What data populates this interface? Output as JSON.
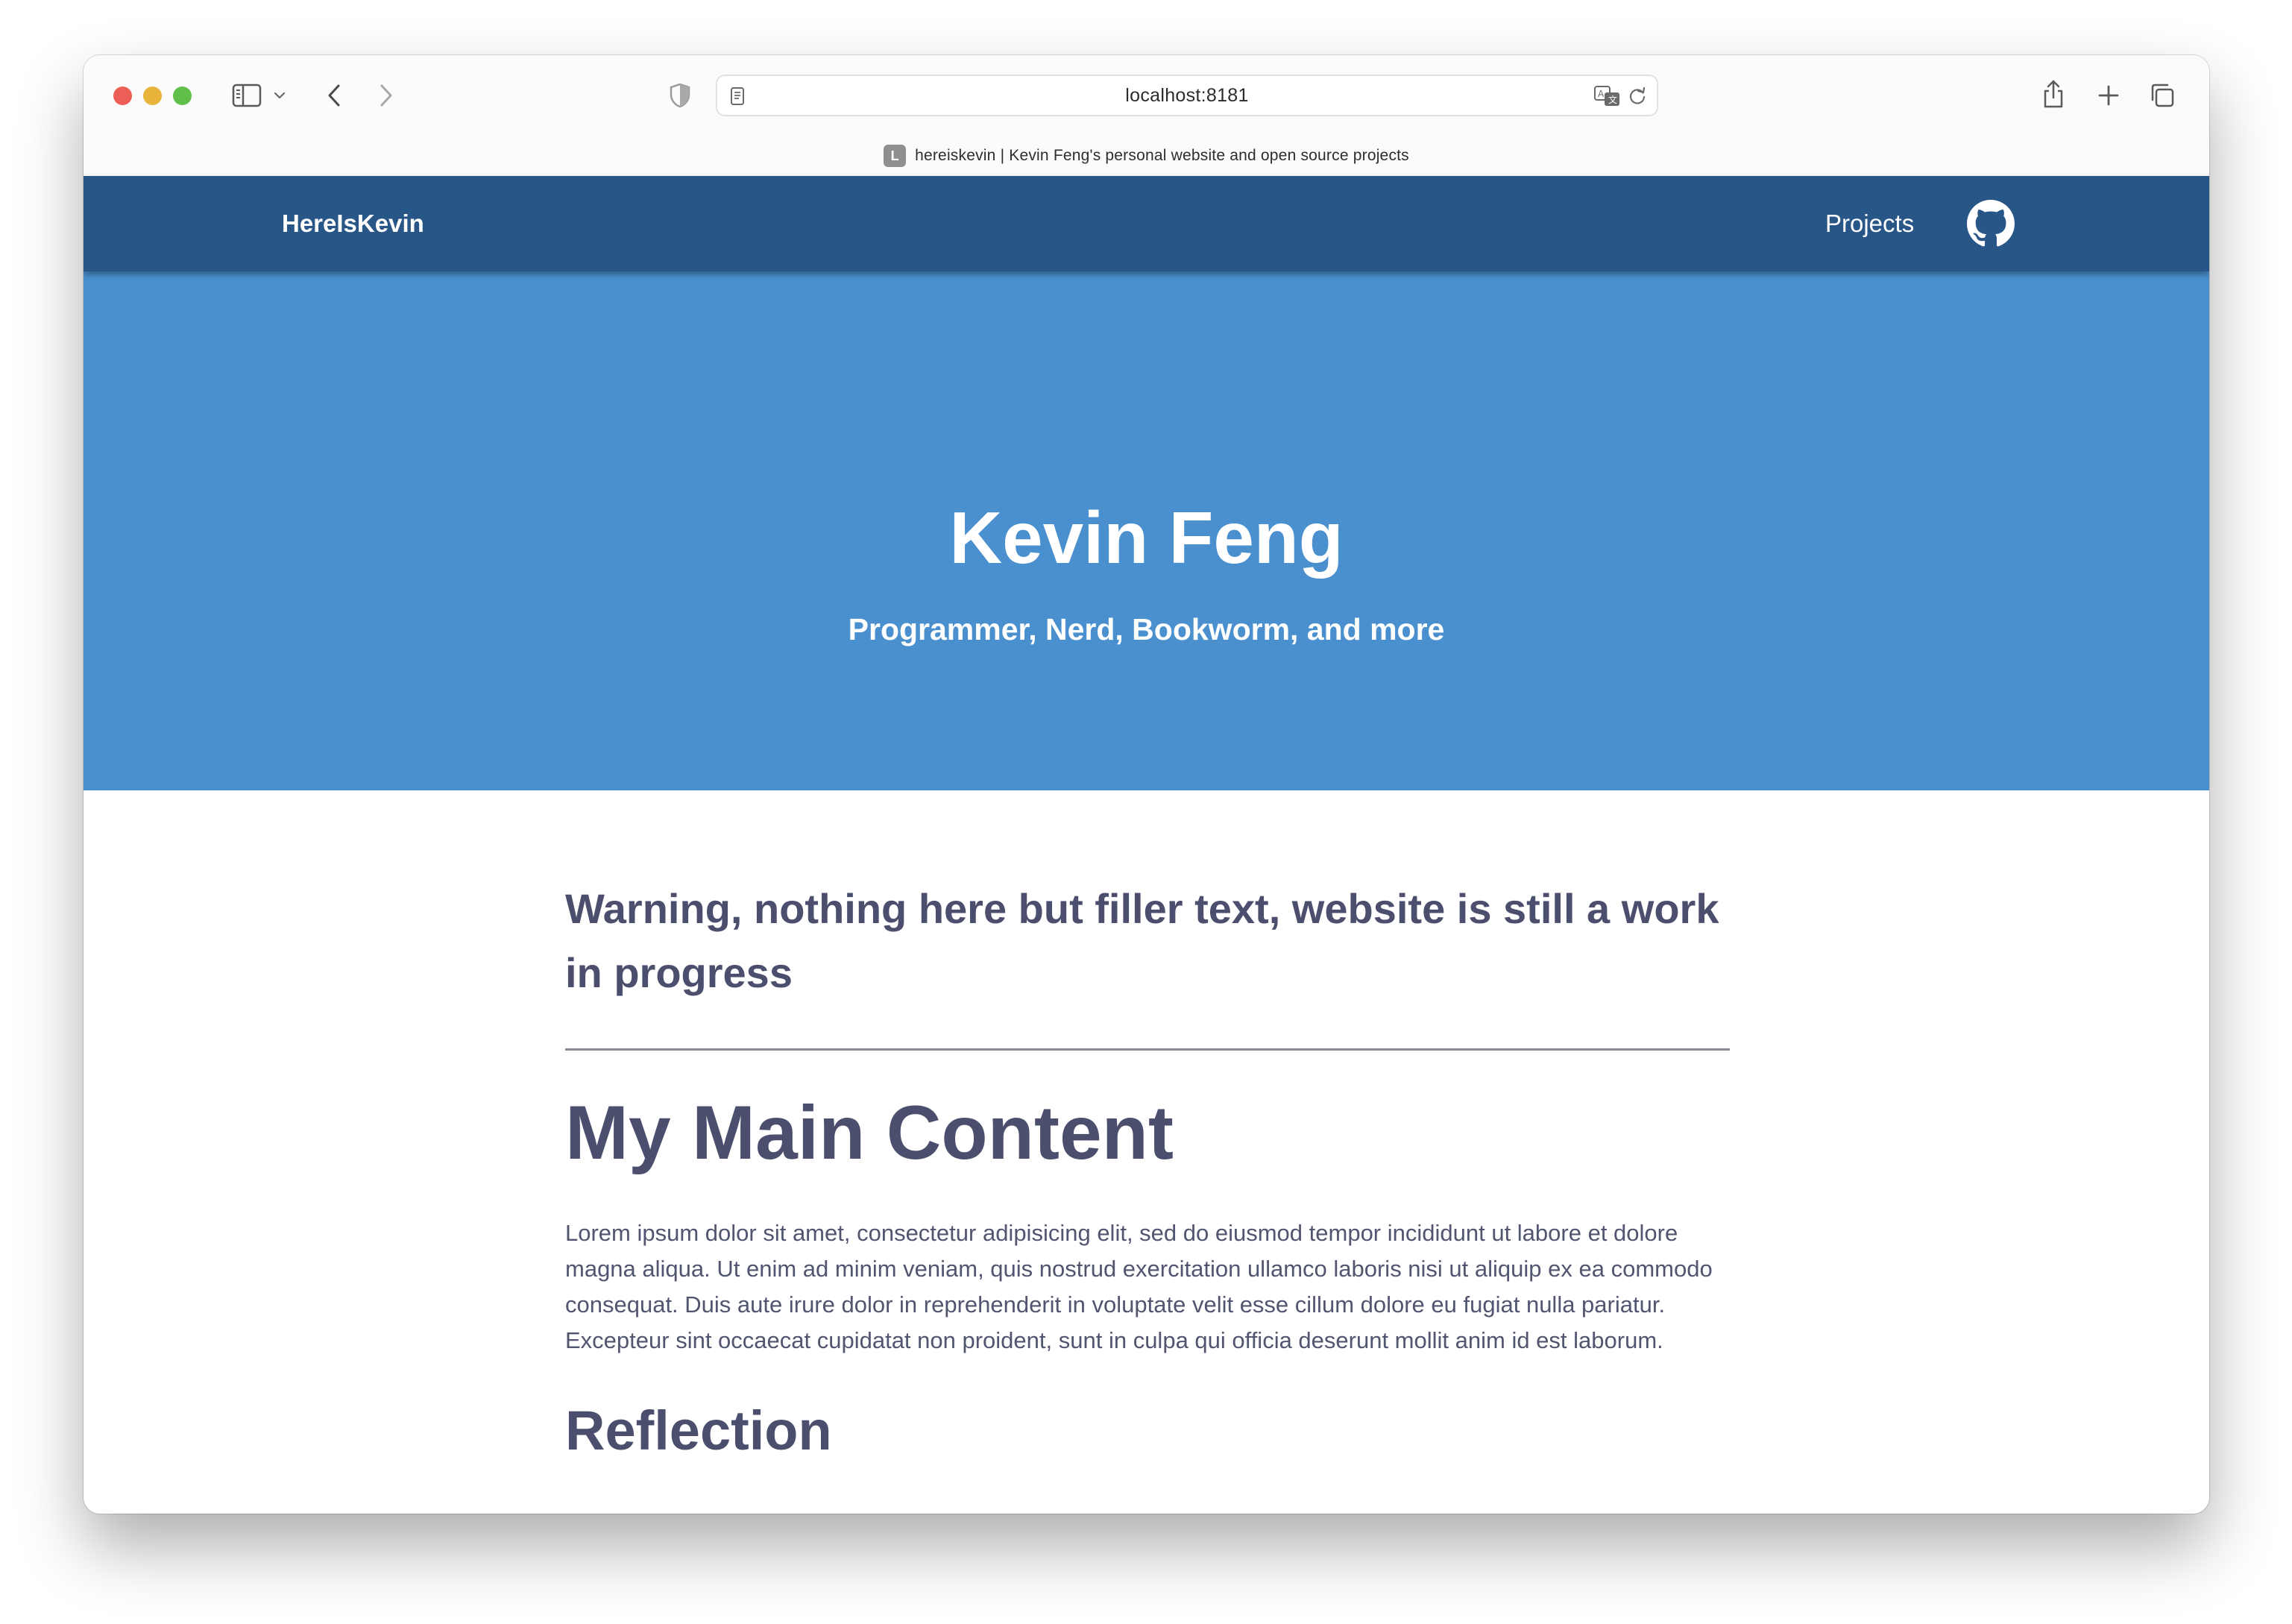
{
  "browser": {
    "url": "localhost:8181",
    "tab": {
      "favicon_letter": "L",
      "title": "hereiskevin | Kevin Feng's personal website and open source projects"
    }
  },
  "nav": {
    "brand": "HereIsKevin",
    "projects": "Projects"
  },
  "hero": {
    "title": "Kevin Feng",
    "subtitle": "Programmer, Nerd, Bookworm, and more"
  },
  "content": {
    "warning": "Warning, nothing here but filler text, website is still a work in progress",
    "main_heading": "My Main Content",
    "paragraph": "Lorem ipsum dolor sit amet, consectetur adipisicing elit, sed do eiusmod tempor incididunt ut labore et dolore magna aliqua. Ut enim ad minim veniam, quis nostrud exercitation ullamco laboris nisi ut aliquip ex ea commodo consequat. Duis aute irure dolor in reprehenderit in voluptate velit esse cillum dolore eu fugiat nulla pariatur. Excepteur sint occaecat cupidatat non proident, sunt in culpa qui officia deserunt mollit anim id est laborum.",
    "reflection_heading": "Reflection"
  },
  "colors": {
    "navbar": "#285687",
    "hero": "#4a90cf",
    "text": "#4b4e6d"
  }
}
